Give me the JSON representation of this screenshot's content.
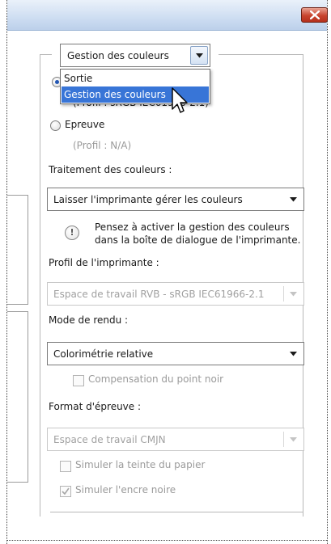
{
  "color_management": {
    "combo_value": "Gestion des couleurs",
    "popup_options": [
      "Sortie",
      "Gestion des couleurs"
    ],
    "partial_hidden_text": "(Profil : sRGB IEC61966-2.1)",
    "radio_output_label": "Sortie",
    "radio_proof_label": "Epreuve",
    "proof_profile_text": "(Profil : N/A)",
    "handling_label": "Traitement des couleurs :",
    "handling_value": "Laisser l'imprimante gérer les couleurs",
    "note_line1": "Pensez à activer la gestion des couleurs",
    "note_line2": "dans la boîte de dialogue de l'imprimante.",
    "printer_profile_label": "Profil de l'imprimante :",
    "printer_profile_value": "Espace de travail RVB - sRGB IEC61966-2.1",
    "rendering_label": "Mode de rendu :",
    "rendering_value": "Colorimétrie relative",
    "black_point_label": "Compensation du point noir",
    "proof_format_label": "Format d'épreuve :",
    "proof_format_value": "Espace de travail CMJN",
    "simulate_paper_label": "Simuler la teinte du papier",
    "simulate_ink_label": "Simuler l'encre noire",
    "simulate_ink_checked": true
  },
  "colors": {
    "selection": "#3875d7",
    "disabled_text": "#9a9a9a",
    "close_button": "#c8442e"
  }
}
